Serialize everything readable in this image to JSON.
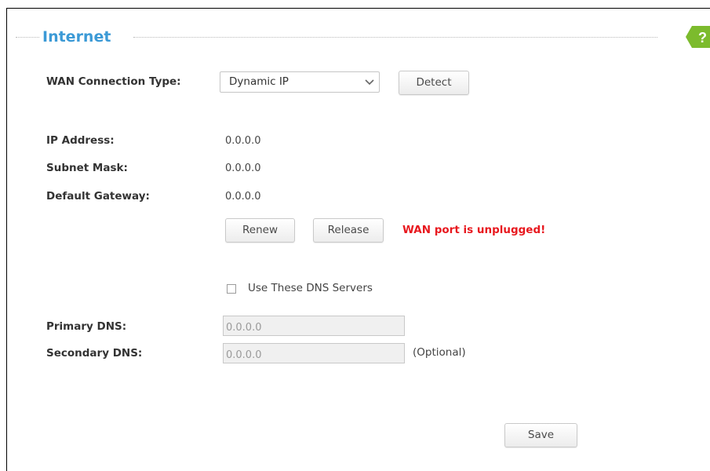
{
  "section": {
    "title": "Internet"
  },
  "wan": {
    "label": "WAN Connection Type:",
    "selected": "Dynamic IP",
    "detect_label": "Detect"
  },
  "status": {
    "ip_label": "IP Address:",
    "ip_value": "0.0.0.0",
    "subnet_label": "Subnet Mask:",
    "subnet_value": "0.0.0.0",
    "gateway_label": "Default Gateway:",
    "gateway_value": "0.0.0.0"
  },
  "actions": {
    "renew_label": "Renew",
    "release_label": "Release",
    "warning": "WAN port is unplugged!"
  },
  "dns": {
    "use_dns_label": "Use These DNS Servers",
    "use_dns_checked": false,
    "primary_label": "Primary DNS:",
    "primary_value": "0.0.0.0",
    "secondary_label": "Secondary DNS:",
    "secondary_value": "0.0.0.0",
    "optional_label": "(Optional)"
  },
  "footer": {
    "save_label": "Save"
  },
  "colors": {
    "title": "#3c9ad6",
    "warning": "#e8191f",
    "help_badge": "#7cbb2d"
  },
  "icons": {
    "help": "help-icon",
    "dropdown": "chevron-down-icon"
  }
}
